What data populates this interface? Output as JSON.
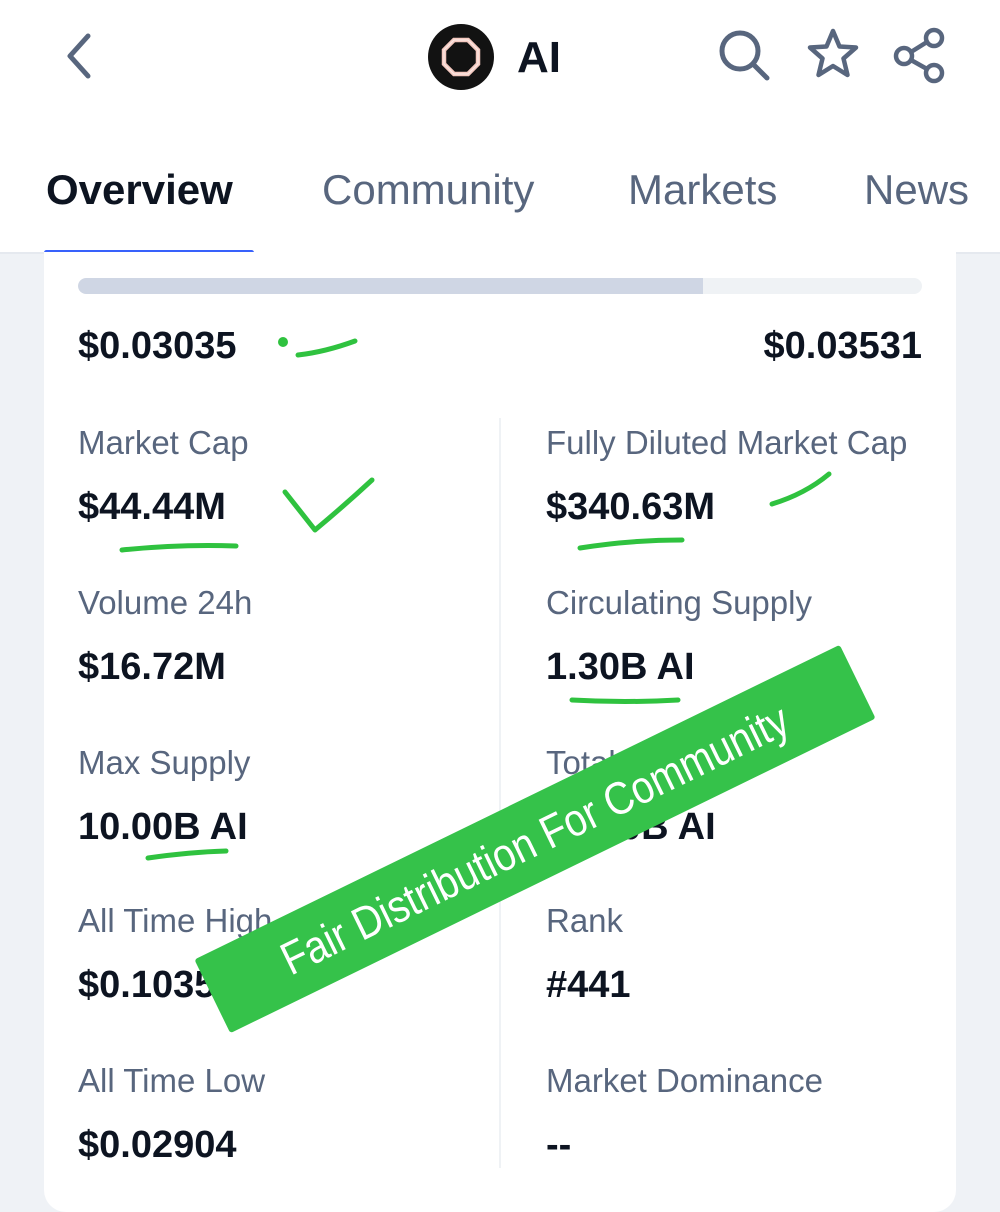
{
  "header": {
    "coin_symbol": "AI",
    "icons": [
      "back-icon",
      "search-icon",
      "star-icon",
      "share-icon"
    ]
  },
  "tabs": [
    {
      "label": "Overview",
      "active": true
    },
    {
      "label": "Community",
      "active": false
    },
    {
      "label": "Markets",
      "active": false
    },
    {
      "label": "News",
      "active": false
    }
  ],
  "price_range": {
    "low": "$0.03035",
    "high": "$0.03531",
    "fill_fraction": 0.74
  },
  "stats": {
    "market_cap": {
      "label": "Market Cap",
      "value": "$44.44M"
    },
    "fully_diluted_market_cap": {
      "label": "Fully Diluted Market Cap",
      "value": "$340.63M"
    },
    "volume_24h": {
      "label": "Volume 24h",
      "value": "$16.72M"
    },
    "circulating_supply": {
      "label": "Circulating Supply",
      "value": "1.30B AI"
    },
    "max_supply": {
      "label": "Max Supply",
      "value": "10.00B AI"
    },
    "total_supply": {
      "label": "Total Supply",
      "value": "10.00B AI"
    },
    "all_time_high": {
      "label": "All Time High",
      "value": "$0.1035"
    },
    "rank": {
      "label": "Rank",
      "value": "#441"
    },
    "all_time_low": {
      "label": "All Time Low",
      "value": "$0.02904"
    },
    "market_dominance": {
      "label": "Market Dominance",
      "value": "--"
    }
  },
  "annotation": {
    "banner_text": "Fair Distribution For Community",
    "ink_color": "#2fc23f"
  },
  "colors": {
    "accent": "#3861fb",
    "text_primary": "#0d1421",
    "text_secondary": "#58667e",
    "banner": "#35c24a"
  }
}
